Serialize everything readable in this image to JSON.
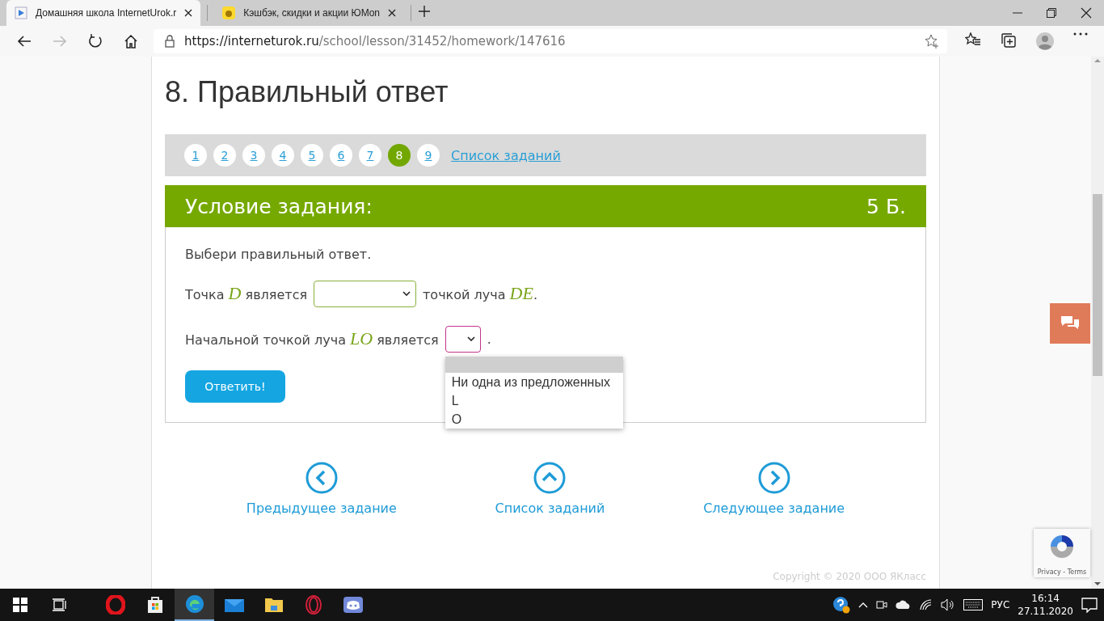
{
  "browser": {
    "tabs": [
      {
        "title": "Домашняя школа InternetUrok.r",
        "selected": true
      },
      {
        "title": "Кэшбэк, скидки и акции ЮMon",
        "selected": false
      }
    ],
    "url_host": "https://interneturok.ru",
    "url_path": "/school/lesson/31452/homework/147616"
  },
  "page": {
    "heading": "8. Правильный ответ",
    "task_nav": {
      "items": [
        {
          "label": "1",
          "selected": false
        },
        {
          "label": "2",
          "selected": false
        },
        {
          "label": "3",
          "selected": false
        },
        {
          "label": "4",
          "selected": false
        },
        {
          "label": "5",
          "selected": false
        },
        {
          "label": "6",
          "selected": false
        },
        {
          "label": "7",
          "selected": false
        },
        {
          "label": "8",
          "selected": true
        },
        {
          "label": "9",
          "selected": false
        }
      ],
      "list_link": "Список заданий"
    },
    "task": {
      "title": "Условие задания:",
      "points": "5 Б.",
      "instruction": "Выбери правильный ответ.",
      "questions": [
        {
          "parts": [
            {
              "kind": "text",
              "text": "Точка *D* является"
            },
            {
              "kind": "select",
              "focused": false
            },
            {
              "kind": "text",
              "text": "точкой луча *DE*."
            }
          ]
        },
        {
          "parts": [
            {
              "kind": "text",
              "text": "Начальной точкой луча *LO* является"
            },
            {
              "kind": "select",
              "focused": true,
              "open": true,
              "blank_highlighted": true,
              "options": [
                "Ни одна из предложенных",
                "L",
                "O"
              ]
            },
            {
              "kind": "text",
              "text": "."
            }
          ]
        }
      ],
      "submit": "Ответить!"
    },
    "bottom_nav": [
      {
        "kind": "prev",
        "label": "Предыдущее задание"
      },
      {
        "kind": "up",
        "label": "Список заданий"
      },
      {
        "kind": "next",
        "label": "Следующее задание"
      }
    ],
    "copyright": "Copyright © 2020 ООО ЯКласс",
    "recaptcha": "Privacy - Terms"
  },
  "taskbar": {
    "apps": [
      {
        "kind": "opera",
        "active": false
      },
      {
        "kind": "store",
        "active": false
      },
      {
        "kind": "edge",
        "active": true
      },
      {
        "kind": "mail",
        "active": false
      },
      {
        "kind": "folder",
        "active": false
      },
      {
        "kind": "opera-gx",
        "active": false
      },
      {
        "kind": "discord",
        "active": false
      }
    ],
    "language": "РУС",
    "time": "16:14",
    "date": "27.11.2020"
  }
}
